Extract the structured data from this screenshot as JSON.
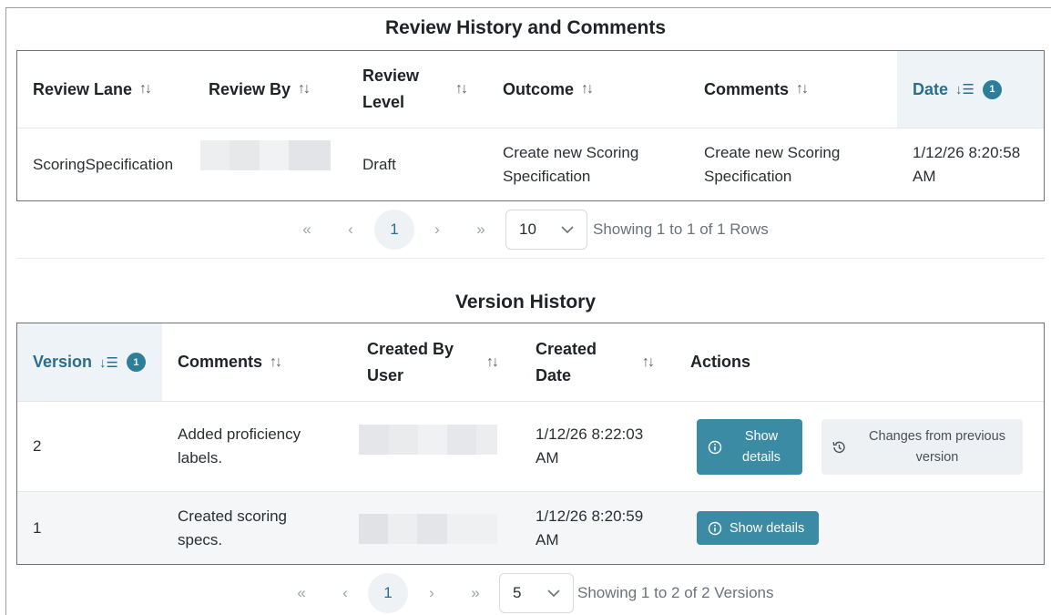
{
  "review": {
    "title": "Review History and Comments",
    "headers": {
      "lane": "Review Lane",
      "by": "Review By",
      "level_1": "Review",
      "level_2": "Level",
      "outcome": "Outcome",
      "comments": "Comments",
      "date": "Date",
      "date_badge": "1"
    },
    "rows": [
      {
        "lane": "ScoringSpecification",
        "level": "Draft",
        "outcome_1": "Create new Scoring",
        "outcome_2": "Specification",
        "comments_1": "Create new Scoring",
        "comments_2": "Specification",
        "date_1": "1/12/26 8:20:58",
        "date_2": "AM"
      }
    ],
    "pager": {
      "first": "«",
      "prev": "‹",
      "page": "1",
      "next": "›",
      "last": "»",
      "page_size": "10",
      "info": "Showing 1 to 1 of 1 Rows"
    }
  },
  "versions": {
    "title": "Version History",
    "headers": {
      "version": "Version",
      "version_badge": "1",
      "comments": "Comments",
      "created_by_1": "Created By",
      "created_by_2": "User",
      "created_date_1": "Created",
      "created_date_2": "Date",
      "actions": "Actions"
    },
    "rows": [
      {
        "version": "2",
        "comments_1": "Added proficiency",
        "comments_2": "labels.",
        "date_1": "1/12/26 8:22:03",
        "date_2": "AM",
        "show_details_1": "Show",
        "show_details_2": "details",
        "changes_1": "Changes from previous",
        "changes_2": "version"
      },
      {
        "version": "1",
        "comments_1": "Created scoring",
        "comments_2": "specs.",
        "date_1": "1/12/26 8:20:59",
        "date_2": "AM",
        "show_details": "Show details"
      }
    ],
    "pager": {
      "first": "«",
      "prev": "‹",
      "page": "1",
      "next": "›",
      "last": "»",
      "page_size": "5",
      "info": "Showing 1 to 2 of 2 Versions"
    }
  },
  "colors": {
    "accent": "#2d7f99",
    "button": "#3a8ba3",
    "active_header_bg": "#eef3f7"
  }
}
